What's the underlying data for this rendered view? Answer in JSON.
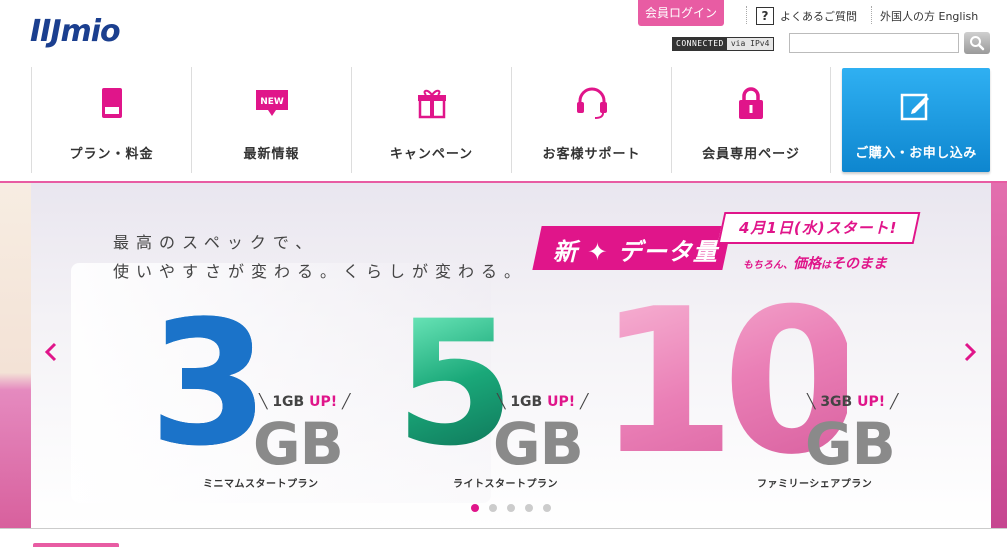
{
  "header": {
    "logo": "IIJmio",
    "login_label": "会員ログイン",
    "faq_icon": "?",
    "faq_label": "よくあるご質問",
    "foreign_label": "外国人の方 English",
    "connection_status": "CONNECTED",
    "connection_protocol": "via IPv4",
    "search_placeholder": "",
    "search_value": ""
  },
  "nav": {
    "items": [
      {
        "label": "プラン・料金",
        "icon": "sim-card-icon"
      },
      {
        "label": "最新情報",
        "icon": "new-badge-icon"
      },
      {
        "label": "キャンペーン",
        "icon": "gift-icon"
      },
      {
        "label": "お客様サポート",
        "icon": "headset-icon"
      },
      {
        "label": "会員専用ページ",
        "icon": "lock-icon"
      }
    ],
    "new_badge": "NEW",
    "cta_label": "ご購入・お申し込み",
    "cta_icon": "edit-icon"
  },
  "hero": {
    "headline_1": "最高のスペックで、",
    "headline_2": "使いやすさが変わる。くらしが変わる。",
    "badge_main": "新 ✦ データ量",
    "badge_date": "4月1日(水)スタート!",
    "badge_sub_pre": "もちろん、",
    "badge_sub_main": "価格",
    "badge_sub_mid": "は",
    "badge_sub_end": "そのまま",
    "plans": [
      {
        "number": "3",
        "unit": "GB",
        "up_amount": "1GB",
        "up_label": "UP!",
        "name": "ミニマムスタートプラン"
      },
      {
        "number": "5",
        "unit": "GB",
        "up_amount": "1GB",
        "up_label": "UP!",
        "name": "ライトスタートプラン"
      },
      {
        "number": "10",
        "unit": "GB",
        "up_amount": "3GB",
        "up_label": "UP!",
        "name": "ファミリーシェアプラン"
      }
    ],
    "slides_total": 5,
    "active_slide": 1,
    "colors": {
      "accent": "#e0158a",
      "brand": "#1b3f8f",
      "cta": "#1a98dd"
    }
  }
}
